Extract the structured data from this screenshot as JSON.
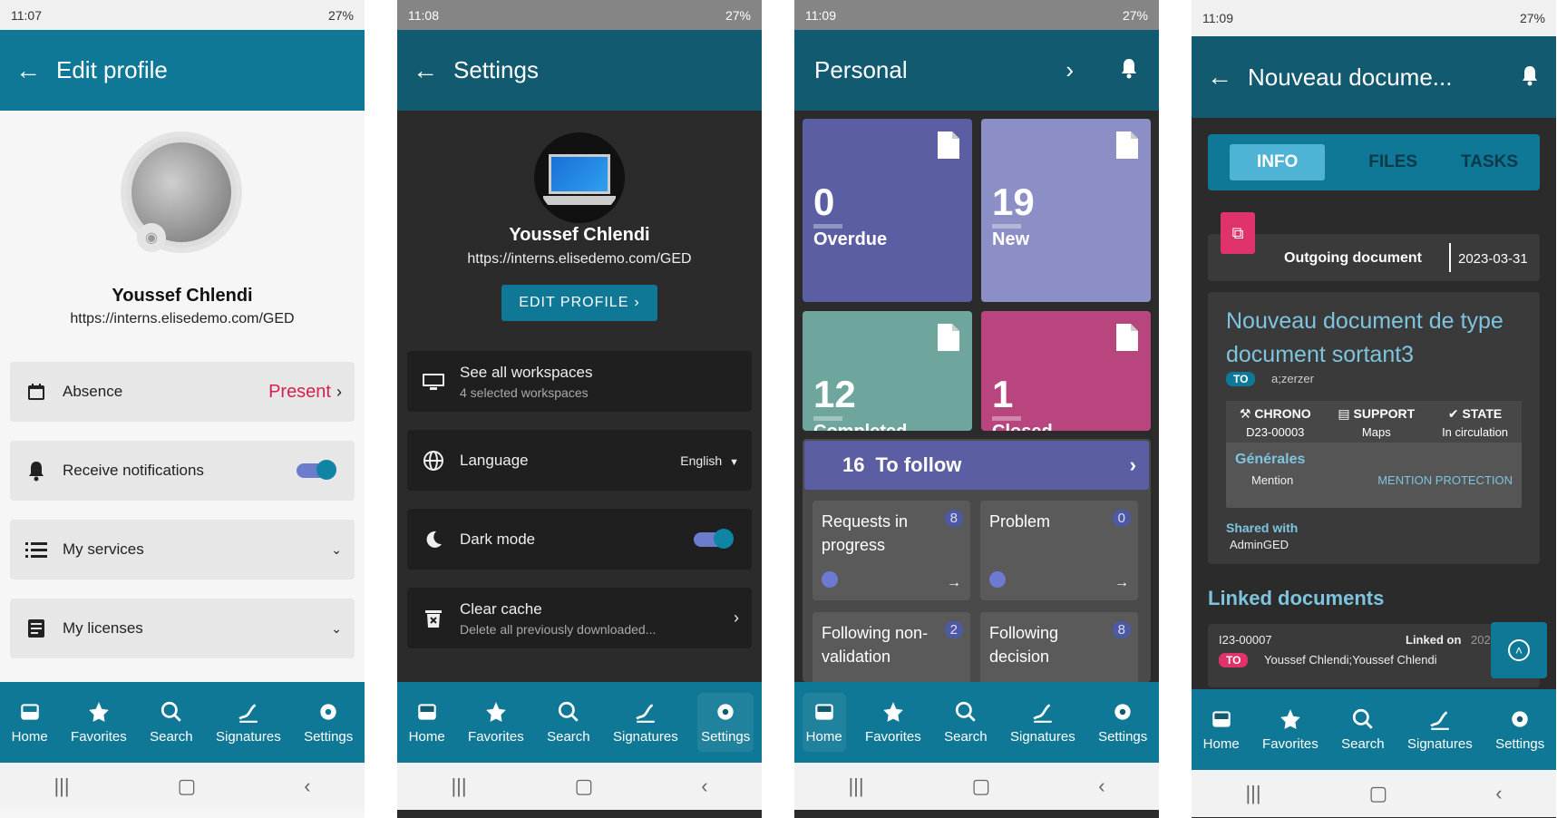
{
  "nav_labels": {
    "home": "Home",
    "favorites": "Favorites",
    "search": "Search",
    "signatures": "Signatures",
    "settings": "Settings"
  },
  "screen1": {
    "time": "11:07",
    "battery": "27%",
    "title": "Edit profile",
    "user_name": "Youssef Chlendi",
    "user_url": "https://interns.elisedemo.com/GED",
    "absence_label": "Absence",
    "absence_value": "Present",
    "notifications_label": "Receive notifications",
    "services_label": "My services",
    "licenses_label": "My licenses",
    "accent_color": "#d5214f"
  },
  "screen2": {
    "time": "11:08",
    "battery": "27%",
    "title": "Settings",
    "user_name": "Youssef Chlendi",
    "user_url": "https://interns.elisedemo.com/GED",
    "edit_button": "EDIT PROFILE",
    "workspaces_label": "See all workspaces",
    "workspaces_sub": "4 selected workspaces",
    "language_label": "Language",
    "language_value": "English",
    "darkmode_label": "Dark mode",
    "cache_label": "Clear cache",
    "cache_sub": "Delete all previously downloaded..."
  },
  "screen3": {
    "time": "11:09",
    "battery": "27%",
    "title": "Personal",
    "tiles": [
      {
        "value": "0",
        "label": "Overdue",
        "color": "#5b5ea2"
      },
      {
        "value": "19",
        "label": "New",
        "color": "#8c8fc6"
      },
      {
        "value": "12",
        "label": "Completed",
        "color": "#6ea69e"
      },
      {
        "value": "1",
        "label": "Closed",
        "color": "#b8457e"
      }
    ],
    "follow_count": "16",
    "follow_label": "To follow",
    "mini": [
      {
        "label": "Requests in progress",
        "count": "8"
      },
      {
        "label": "Problem",
        "count": "0"
      },
      {
        "label": "Following non-validation",
        "count": "2"
      },
      {
        "label": "Following decision",
        "count": "8"
      }
    ]
  },
  "screen4": {
    "time": "11:09",
    "battery": "27%",
    "title": "Nouveau docume...",
    "tabs": [
      "INFO",
      "FILES",
      "TASKS"
    ],
    "doc_type": "Outgoing document",
    "doc_date": "2023-03-31",
    "doc_title": "Nouveau document de type document sortant3",
    "to_badge": "TO",
    "to_value": "a;zerzer",
    "chrono_label": "CHRONO",
    "chrono_value": "D23-00003",
    "support_label": "SUPPORT",
    "support_value": "Maps",
    "state_label": "STATE",
    "state_value": "In circulation",
    "generales": "Générales",
    "mention_label": "Mention",
    "mention_value": "MENTION PROTECTION",
    "shared_label": "Shared with",
    "shared_value": "AdminGED",
    "linked_title": "Linked documents",
    "linked_id": "I23-00007",
    "linked_on": "Linked on",
    "linked_date": "2023",
    "linked_to": "Youssef Chlendi;Youssef Chlendi",
    "pink": "#e0336b"
  }
}
